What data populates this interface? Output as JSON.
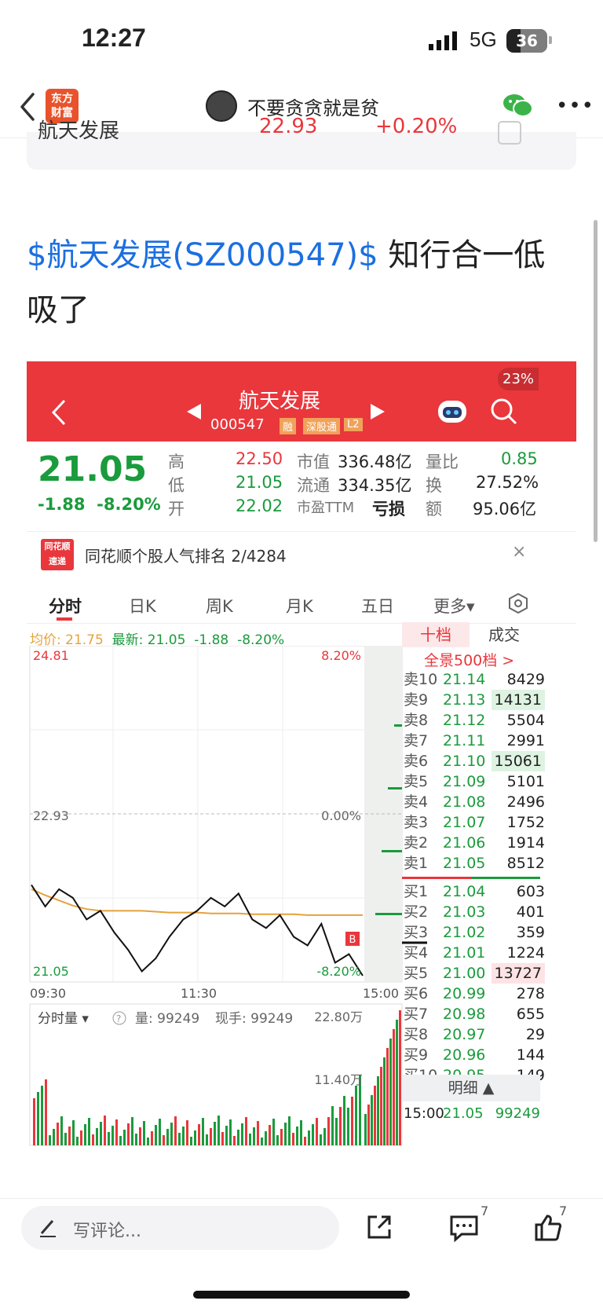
{
  "status": {
    "time": "12:27",
    "network": "5G",
    "battery": "36"
  },
  "nav": {
    "logo_line1": "东方",
    "logo_line2": "财富",
    "username": "不要贪贪就是贫"
  },
  "top_card": {
    "name": "航天发展",
    "price": "22.93",
    "change": "+0.20%"
  },
  "post": {
    "tag": "$航天发展(SZ000547)$",
    "text": " 知行合一低吸了"
  },
  "stock": {
    "name": "航天发展",
    "code": "000547",
    "badges": [
      "融",
      "深股通",
      "L2"
    ],
    "battery_badge": "23%",
    "price": "21.05",
    "change": "-1.88",
    "change_pct": "-8.20%",
    "high_label": "高",
    "high": "22.50",
    "low_label": "低",
    "low": "21.05",
    "open_label": "开",
    "open": "22.02",
    "mcap_label": "市值",
    "mcap": "336.48亿",
    "float_label": "流通",
    "float": "334.35亿",
    "pe_label": "市盈TTM",
    "pe": "亏损",
    "vr_label": "量比",
    "vr": "0.85",
    "turnover_label": "换",
    "turnover": "27.52%",
    "amount_label": "额",
    "amount": "95.06亿"
  },
  "rank": {
    "logo1": "同花顺",
    "logo2": "速递",
    "text": "同花顺个股人气排名 2/4284"
  },
  "tabs": [
    "分时",
    "日K",
    "周K",
    "月K",
    "五日",
    "更多▾"
  ],
  "avg_line": {
    "avg_label": "均价: 21.75",
    "latest_label": "最新: 21.05",
    "chg": "-1.88",
    "pct": "-8.20%"
  },
  "chart_labels": {
    "top_price": "24.81",
    "top_pct": "8.20%",
    "mid_price": "22.93",
    "mid_pct": "0.00%",
    "bot_price": "21.05",
    "bot_pct": "-8.20%",
    "t_start": "09:30",
    "t_mid": "11:30",
    "t_end": "15:00",
    "b_mark": "B"
  },
  "volume": {
    "label": "分时量 ▾",
    "vol": "量: 99249",
    "hand": "现手: 99249",
    "max": "22.80万",
    "mid": "11.40万"
  },
  "order_book": {
    "tab_active": "十档",
    "tab_other": "成交",
    "full": "全景500档 >",
    "asks": [
      {
        "label": "卖10",
        "price": "21.14",
        "vol": "8429"
      },
      {
        "label": "卖9",
        "price": "21.13",
        "vol": "14131"
      },
      {
        "label": "卖8",
        "price": "21.12",
        "vol": "5504"
      },
      {
        "label": "卖7",
        "price": "21.11",
        "vol": "2991"
      },
      {
        "label": "卖6",
        "price": "21.10",
        "vol": "15061"
      },
      {
        "label": "卖5",
        "price": "21.09",
        "vol": "5101"
      },
      {
        "label": "卖4",
        "price": "21.08",
        "vol": "2496"
      },
      {
        "label": "卖3",
        "price": "21.07",
        "vol": "1752"
      },
      {
        "label": "卖2",
        "price": "21.06",
        "vol": "1914"
      },
      {
        "label": "卖1",
        "price": "21.05",
        "vol": "8512"
      }
    ],
    "bids": [
      {
        "label": "买1",
        "price": "21.04",
        "vol": "603"
      },
      {
        "label": "买2",
        "price": "21.03",
        "vol": "401"
      },
      {
        "label": "买3",
        "price": "21.02",
        "vol": "359"
      },
      {
        "label": "买4",
        "price": "21.01",
        "vol": "1224"
      },
      {
        "label": "买5",
        "price": "21.00",
        "vol": "13727"
      },
      {
        "label": "买6",
        "price": "20.99",
        "vol": "278"
      },
      {
        "label": "买7",
        "price": "20.98",
        "vol": "655"
      },
      {
        "label": "买8",
        "price": "20.97",
        "vol": "29"
      },
      {
        "label": "买9",
        "price": "20.96",
        "vol": "144"
      },
      {
        "label": "买10",
        "price": "20.95",
        "vol": "149"
      }
    ],
    "detail_label": "明细 ▲",
    "last_trade": {
      "time": "15:00",
      "price": "21.05",
      "vol": "99249"
    }
  },
  "toolbar": {
    "comment_placeholder": "写评论...",
    "comments_count": "7",
    "likes_count": "7"
  },
  "chart_data": {
    "type": "line",
    "title": "",
    "xlabel": "",
    "ylabel": "",
    "x_ticks": [
      "09:30",
      "11:30",
      "15:00"
    ],
    "ylim": [
      21.05,
      24.81
    ],
    "y_ticks": [
      "24.81",
      "22.93",
      "21.05"
    ],
    "series": [
      {
        "values": [
          22.1,
          21.85,
          22.05,
          21.95,
          21.7,
          21.8,
          21.55,
          21.35,
          21.1,
          21.25,
          21.5,
          21.7,
          21.8,
          21.95,
          21.85,
          22.0,
          21.7,
          21.6,
          21.75,
          21.5,
          21.4,
          21.65,
          21.2,
          21.3,
          21.05
        ]
      },
      {
        "values": [
          22.05,
          21.98,
          21.92,
          21.86,
          21.82,
          21.8,
          21.8,
          21.8,
          21.8,
          21.79,
          21.78,
          21.78,
          21.78,
          21.77,
          21.77,
          21.77,
          21.76,
          21.76,
          21.76,
          21.76,
          21.75,
          21.75,
          21.75,
          21.75,
          21.75
        ]
      }
    ]
  }
}
